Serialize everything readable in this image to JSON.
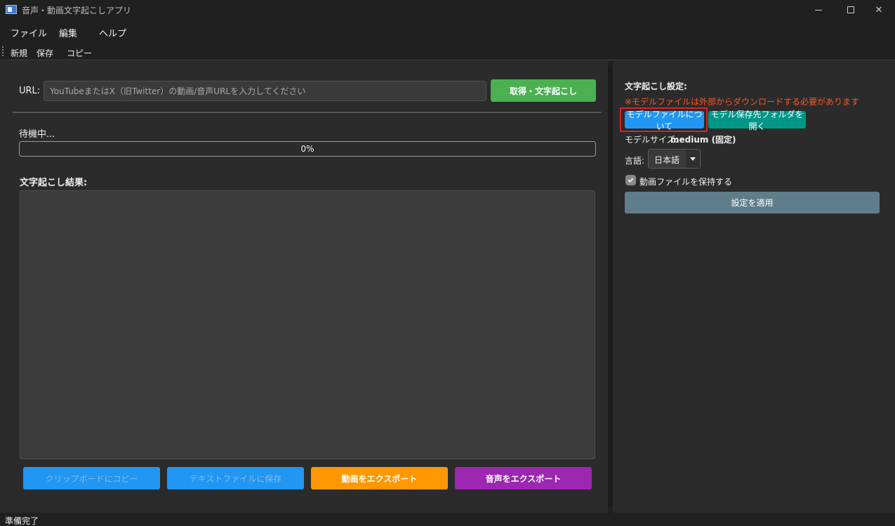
{
  "window": {
    "title": "音声・動画文字起こしアプリ"
  },
  "menu": {
    "file": "ファイル",
    "edit": "編集",
    "help": "ヘルプ"
  },
  "toolbar": {
    "new": "新規",
    "save": "保存",
    "copy": "コピー"
  },
  "url": {
    "label": "URL:",
    "placeholder": "YouTubeまたはX（旧Twitter）の動画/音声URLを入力してください",
    "value": "",
    "fetch_button": "取得・文字起こし"
  },
  "status": {
    "text": "待機中...",
    "progress_percent": 0,
    "progress_label": "0%"
  },
  "result": {
    "label": "文字起こし結果:",
    "text": ""
  },
  "actions": {
    "copy_clipboard": "クリップボードにコピー",
    "save_text": "テキストファイルに保存",
    "export_video": "動画をエクスポート",
    "export_audio": "音声をエクスポート"
  },
  "settings": {
    "title": "文字起こし設定:",
    "warning": "※モデルファイルは外部からダウンロードする必要があります",
    "model_info_button": "モデルファイルについて",
    "model_folder_button": "モデル保存先フォルダを開く",
    "model_size_label": "モデルサイズ:",
    "model_size_value": "medium (固定)",
    "language_label": "言語:",
    "language_value": "日本語",
    "keep_video_label": "動画ファイルを保持する",
    "keep_video_checked": true,
    "apply_button": "設定を適用"
  },
  "statusbar": {
    "text": "準備完了"
  },
  "colors": {
    "green": "#4caf50",
    "blue": "#2196f3",
    "orange": "#ff9800",
    "purple": "#9c27b0",
    "teal": "#009688",
    "slate": "#607d8b",
    "warning": "#ff5722",
    "highlight": "#e02020"
  }
}
